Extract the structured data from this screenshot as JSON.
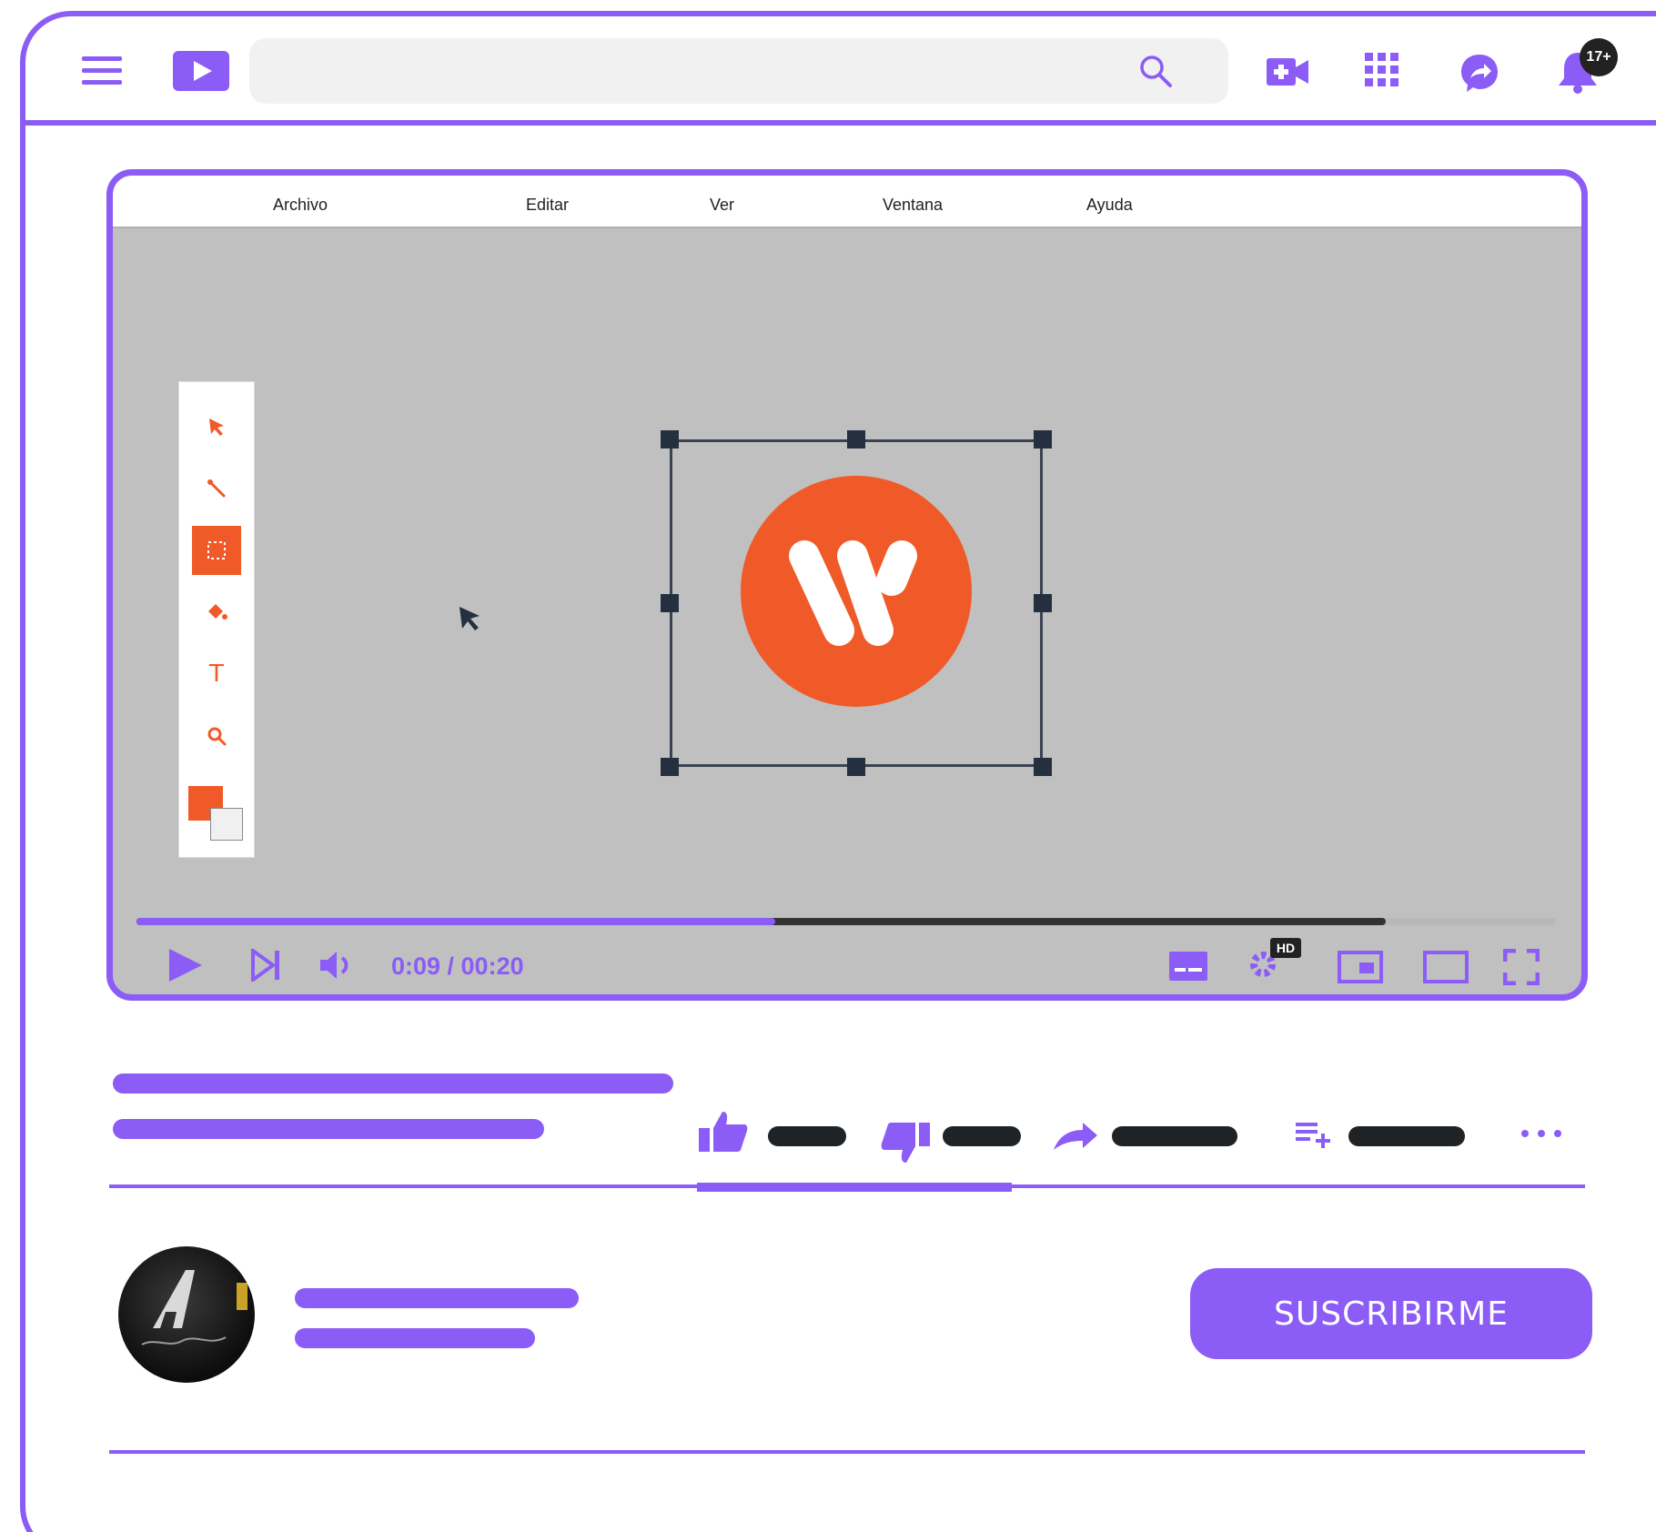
{
  "header": {
    "search_placeholder": "",
    "notification_count": "17+"
  },
  "app_menu": [
    "Archivo",
    "Editar",
    "Ver",
    "Ventana",
    "Ayuda"
  ],
  "player": {
    "time": "0:09 / 00:20",
    "played_fraction": 0.45,
    "buffered_fraction": 0.88,
    "hd_label": "HD"
  },
  "channel": {
    "subscribe_label": "SUSCRIBIRME"
  },
  "colors": {
    "accent": "#8b5cf6",
    "logo_orange": "#f05a28",
    "canvas_gray": "#c0c0c0"
  }
}
